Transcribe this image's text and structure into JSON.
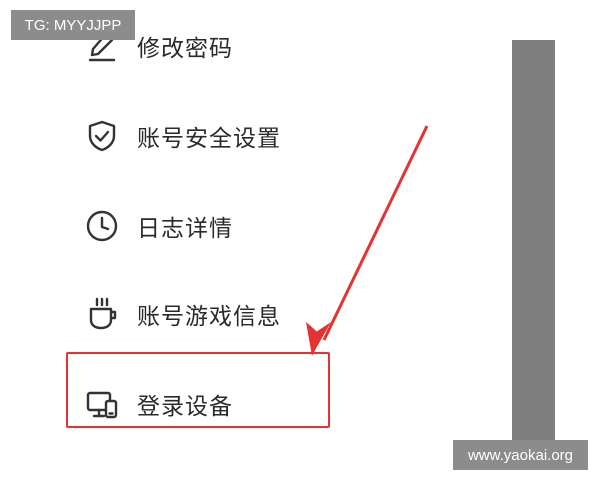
{
  "watermark_top": "TG: MYYJJPP",
  "watermark_bottom": "www.yaokai.org",
  "menu": {
    "items": [
      {
        "label": "修改密码",
        "icon": "pencil-icon"
      },
      {
        "label": "账号安全设置",
        "icon": "shield-check-icon"
      },
      {
        "label": "日志详情",
        "icon": "clock-icon"
      },
      {
        "label": "账号游戏信息",
        "icon": "coffee-cup-icon"
      },
      {
        "label": "登录设备",
        "icon": "devices-icon"
      }
    ]
  },
  "colors": {
    "highlight": "#e53232",
    "arrow": "#e53232",
    "scrollbar": "#7f7f7f",
    "watermark_bg": "#8c8c8c"
  }
}
